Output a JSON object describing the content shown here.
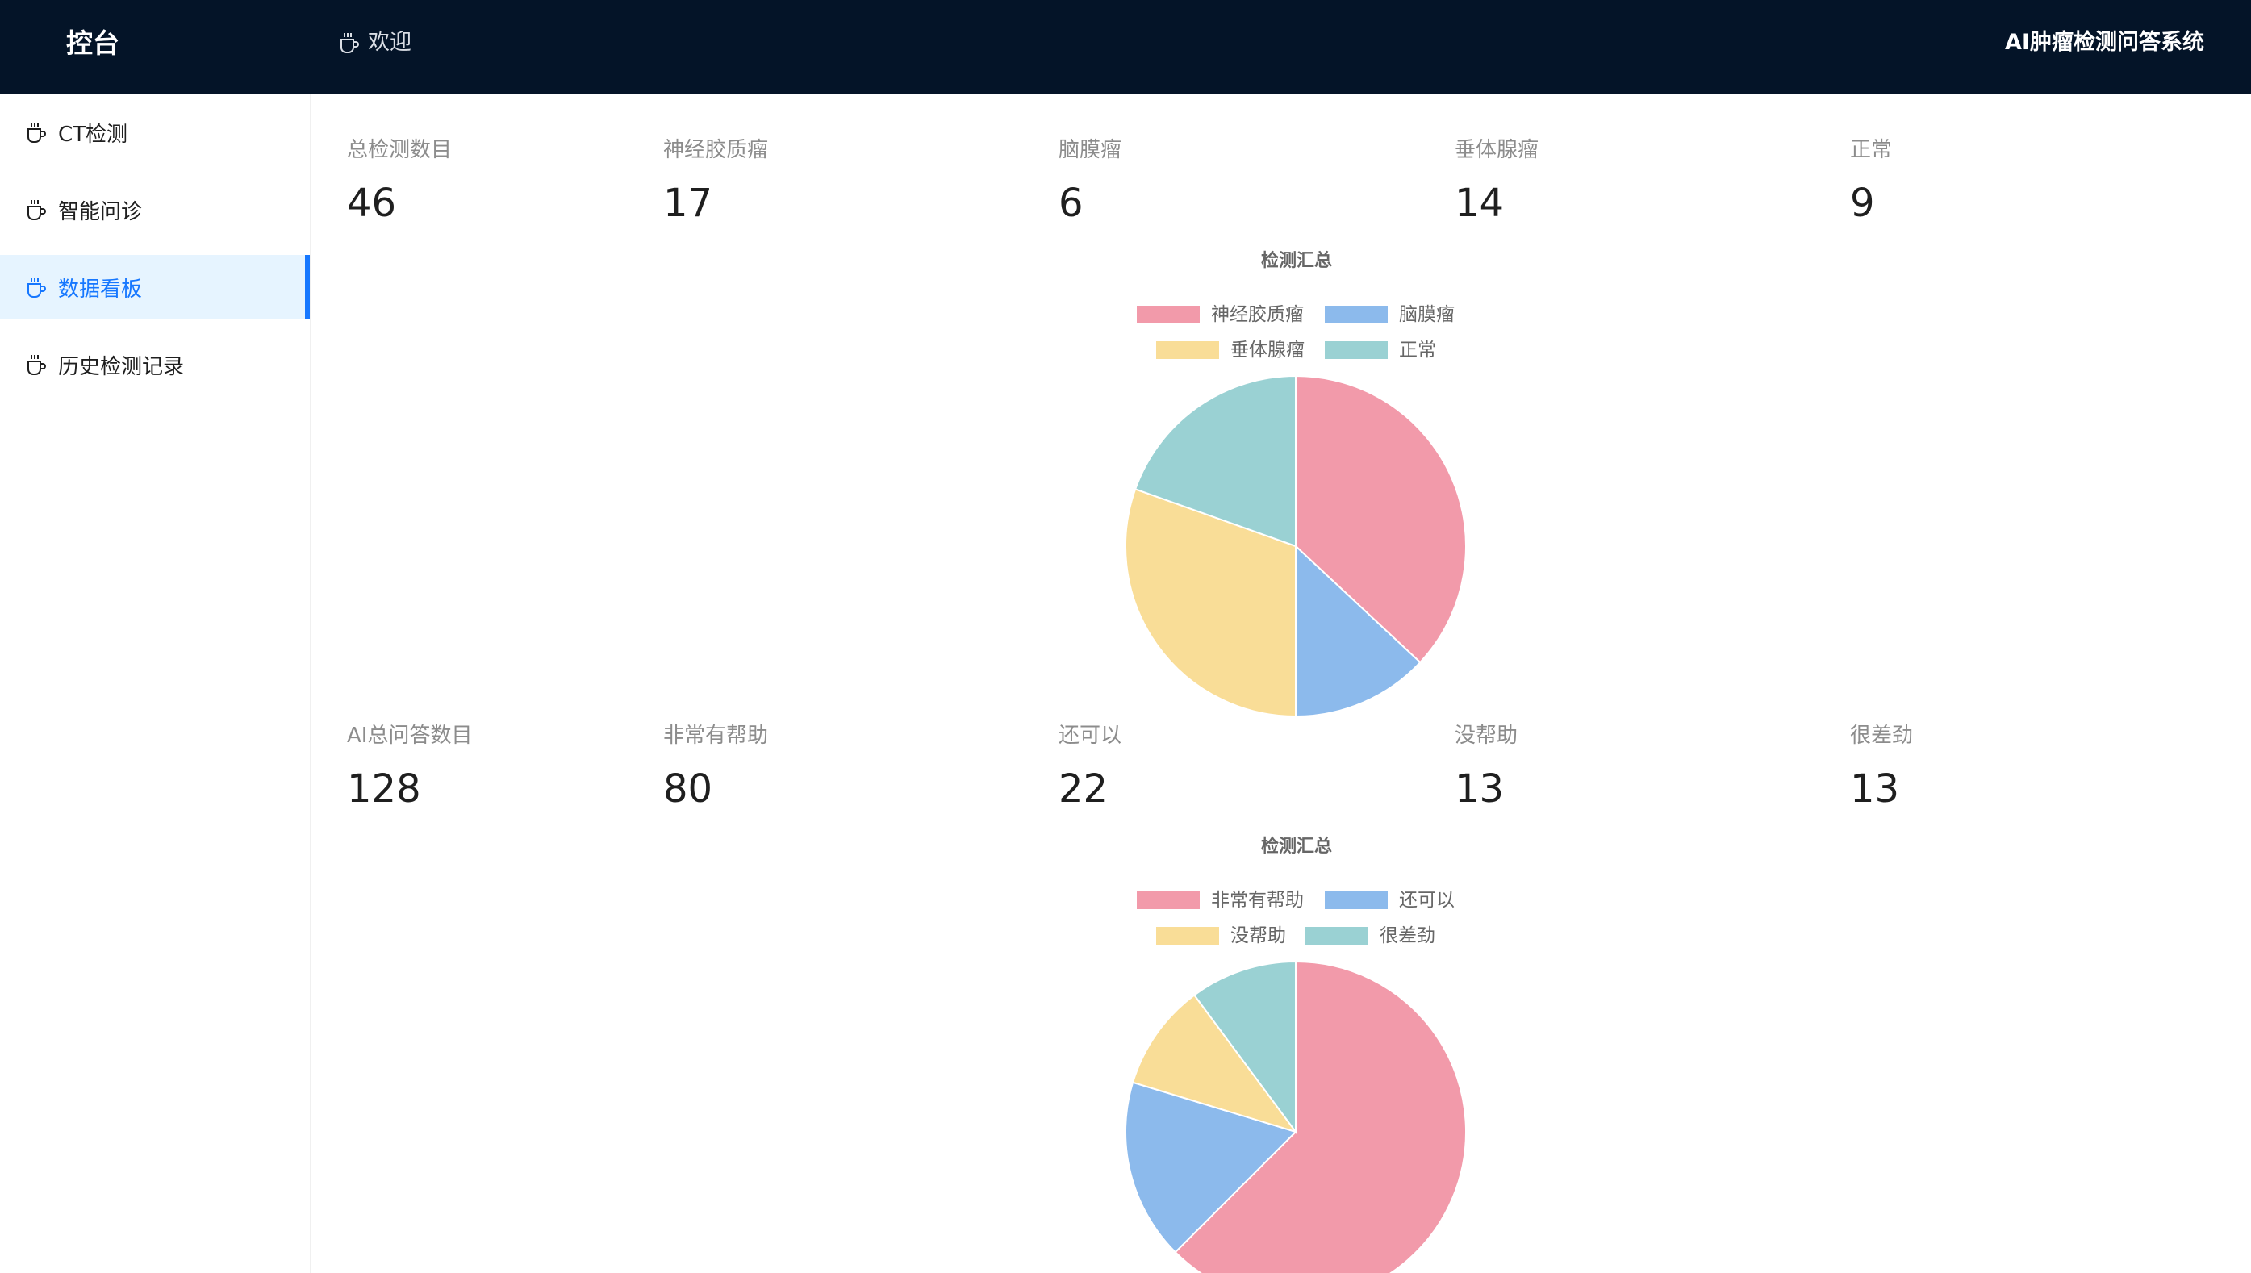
{
  "header": {
    "brand": "控台",
    "welcome": "欢迎",
    "system_title": "AI肿瘤检测问答系统"
  },
  "sidebar": {
    "items": [
      {
        "label": "CT检测",
        "icon": "coffee-cup-icon",
        "active": false
      },
      {
        "label": "智能问诊",
        "icon": "coffee-cup-icon",
        "active": false
      },
      {
        "label": "数据看板",
        "icon": "coffee-cup-icon",
        "active": true
      },
      {
        "label": "历史检测记录",
        "icon": "coffee-cup-icon",
        "active": false
      }
    ]
  },
  "detection_stats": [
    {
      "label": "总检测数目",
      "value": "46"
    },
    {
      "label": "神经胶质瘤",
      "value": "17"
    },
    {
      "label": "脑膜瘤",
      "value": "6"
    },
    {
      "label": "垂体腺瘤",
      "value": "14"
    },
    {
      "label": "正常",
      "value": "9"
    }
  ],
  "qa_stats": [
    {
      "label": "AI总问答数目",
      "value": "128"
    },
    {
      "label": "非常有帮助",
      "value": "80"
    },
    {
      "label": "还可以",
      "value": "22"
    },
    {
      "label": "没帮助",
      "value": "13"
    },
    {
      "label": "很差劲",
      "value": "13"
    }
  ],
  "colors": {
    "header_bg": "#041428",
    "accent": "#1677ff",
    "pink": "#f29aaa",
    "blue": "#8cbaec",
    "yellow": "#f9dd97",
    "teal": "#9ad1d3"
  },
  "chart_data": [
    {
      "type": "pie",
      "title": "检测汇总",
      "legend_position": "top",
      "categories": [
        "神经胶质瘤",
        "脑膜瘤",
        "垂体腺瘤",
        "正常"
      ],
      "values": [
        17,
        6,
        14,
        9
      ],
      "colors": [
        "#f29aaa",
        "#8cbaec",
        "#f9dd97",
        "#9ad1d3"
      ]
    },
    {
      "type": "pie",
      "title": "检测汇总",
      "legend_position": "top",
      "categories": [
        "非常有帮助",
        "还可以",
        "没帮助",
        "很差劲"
      ],
      "values": [
        80,
        22,
        13,
        13
      ],
      "colors": [
        "#f29aaa",
        "#8cbaec",
        "#f9dd97",
        "#9ad1d3"
      ]
    }
  ]
}
